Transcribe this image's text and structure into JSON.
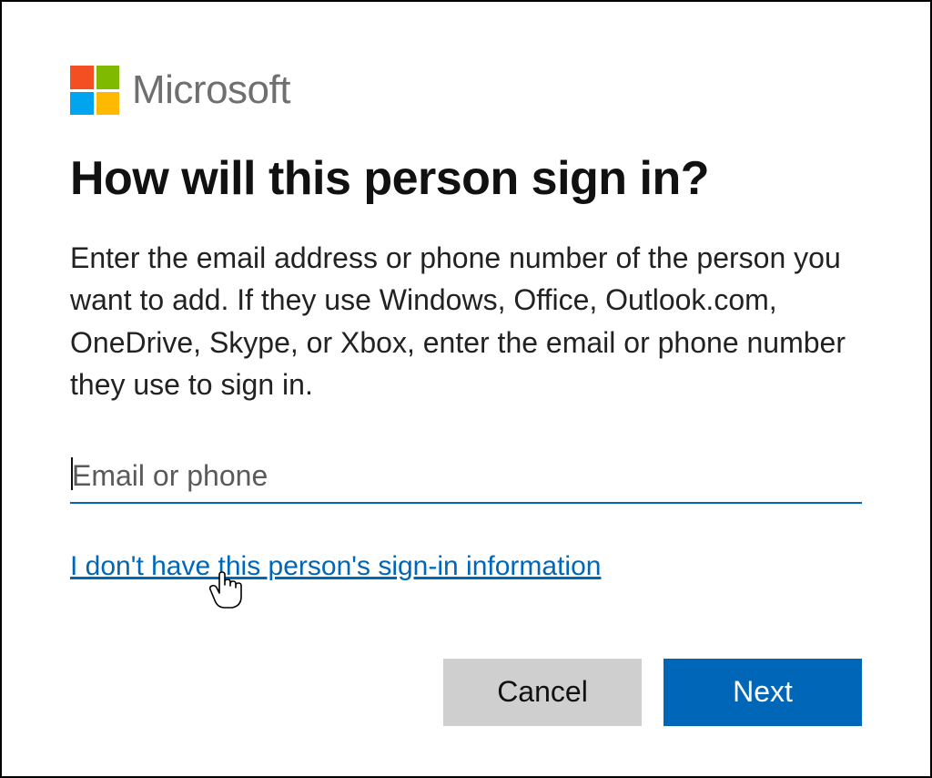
{
  "brand": "Microsoft",
  "title": "How will this person sign in?",
  "description": "Enter the email address or phone number of the person you want to add. If they use Windows, Office, Outlook.com, OneDrive, Skype, or Xbox, enter the email or phone number they use to sign in.",
  "input": {
    "placeholder": "Email or phone",
    "value": ""
  },
  "link": "I don't have this person's sign-in information",
  "buttons": {
    "cancel": "Cancel",
    "next": "Next"
  },
  "colors": {
    "accent": "#0067b8",
    "cancel_bg": "#cfcfcf",
    "logo_red": "#f25022",
    "logo_green": "#7fba00",
    "logo_blue": "#00a4ef",
    "logo_yellow": "#ffb900"
  }
}
